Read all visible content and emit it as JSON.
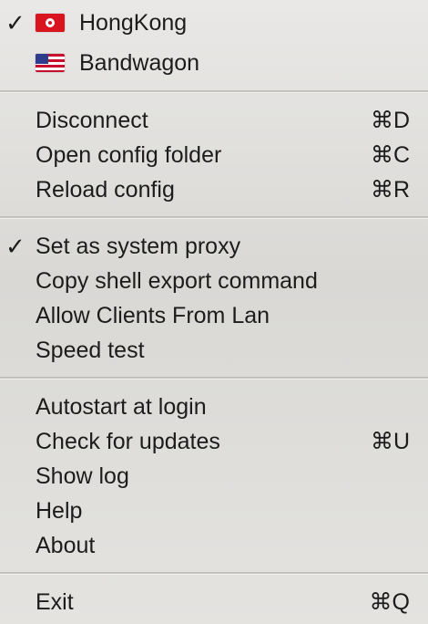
{
  "servers": [
    {
      "label": "HongKong",
      "flag": "hk-flag-icon",
      "checked": true
    },
    {
      "label": "Bandwagon",
      "flag": "us-flag-icon",
      "checked": false
    }
  ],
  "check_mark": "✓",
  "actions": {
    "disconnect": {
      "label": "Disconnect",
      "shortcut": "⌘D"
    },
    "open_config_folder": {
      "label": "Open config folder",
      "shortcut": "⌘C"
    },
    "reload_config": {
      "label": "Reload config",
      "shortcut": "⌘R"
    }
  },
  "proxy": {
    "set_system_proxy": {
      "label": "Set as system proxy",
      "checked": true
    },
    "copy_shell_export": {
      "label": "Copy shell export command"
    },
    "allow_lan": {
      "label": "Allow Clients From Lan"
    },
    "speed_test": {
      "label": "Speed test"
    }
  },
  "general": {
    "autostart": {
      "label": "Autostart at login"
    },
    "check_updates": {
      "label": "Check for updates",
      "shortcut": "⌘U"
    },
    "show_log": {
      "label": "Show log"
    },
    "help": {
      "label": "Help"
    },
    "about": {
      "label": "About"
    }
  },
  "exit": {
    "label": "Exit",
    "shortcut": "⌘Q"
  }
}
